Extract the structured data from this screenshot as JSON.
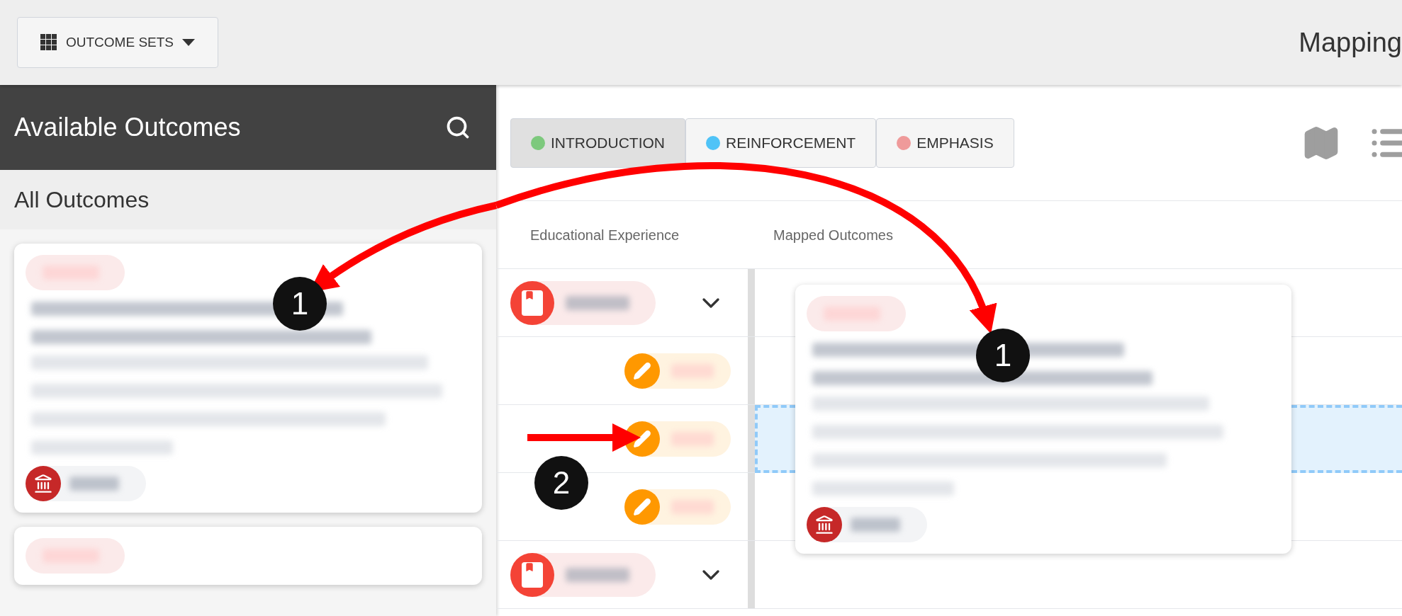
{
  "toolbar": {
    "outcome_sets_button": "OUTCOME SETS",
    "title": "Mapping"
  },
  "sidebar": {
    "title": "Available Outcomes",
    "section": "All Outcomes",
    "cards": [
      {
        "kind": "outcome"
      },
      {
        "kind": "outcome"
      }
    ]
  },
  "filters": [
    {
      "label": "INTRODUCTION",
      "color": "#7dc97d",
      "selected": true
    },
    {
      "label": "REINFORCEMENT",
      "color": "#4fc3f7",
      "selected": false
    },
    {
      "label": "EMPHASIS",
      "color": "#ef9a9a",
      "selected": false
    }
  ],
  "table": {
    "columns": [
      "Educational Experience",
      "Mapped Outcomes"
    ],
    "rows": [
      {
        "kind": "course"
      },
      {
        "kind": "activity",
        "drop_target": false
      },
      {
        "kind": "activity",
        "drop_target": true
      },
      {
        "kind": "activity",
        "drop_target": false
      },
      {
        "kind": "course"
      }
    ]
  },
  "annotations": [
    {
      "kind": "curve",
      "label": "1"
    },
    {
      "kind": "curve",
      "label": "1"
    },
    {
      "kind": "straight",
      "label": "2"
    }
  ]
}
